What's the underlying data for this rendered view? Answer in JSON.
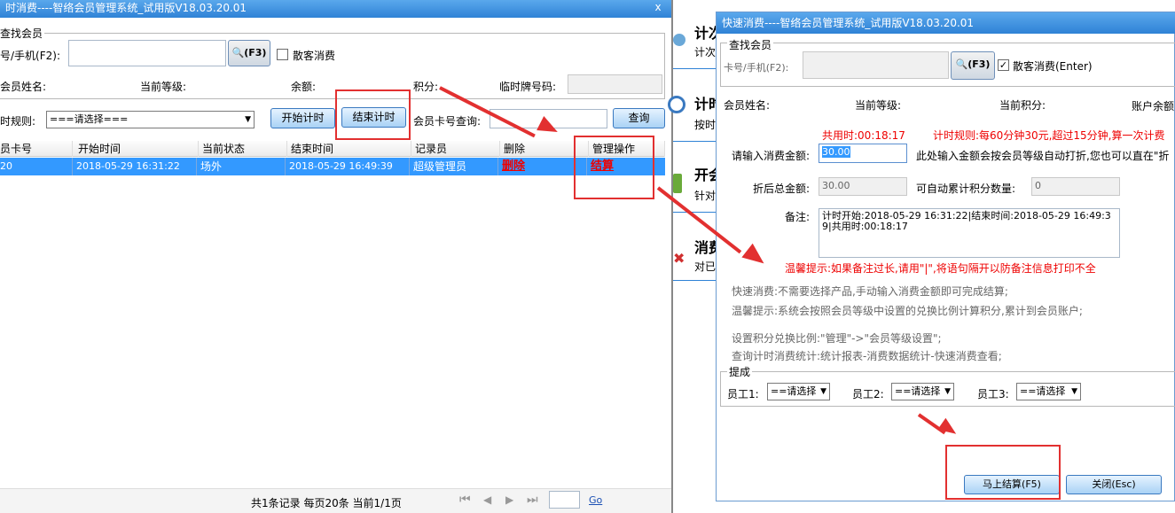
{
  "left_window": {
    "title": "时消费----智络会员管理系统_试用版V18.03.20.01",
    "close_glyph": "x",
    "find_member_group": "查找会员",
    "card_phone_label": "号/手机(F2):",
    "card_phone_value": "",
    "search_button": "(F3)",
    "walkin_label": "散客消费",
    "walkin_checked": false,
    "member_name_label": "会员姓名:",
    "current_level_label": "当前等级:",
    "balance_label": "余额:",
    "points_label": "积分:",
    "temp_card_label": "临时牌号码:",
    "temp_card_value": "",
    "rule_label": "时规则:",
    "rule_select": "===请选择===",
    "start_button": "开始计时",
    "end_button": "结束计时",
    "card_query_label": "会员卡号查询:",
    "card_query_value": "",
    "query_button": "查询",
    "table": {
      "headers": [
        "员卡号",
        "开始时间",
        "当前状态",
        "结束时间",
        "记录员",
        "删除",
        "管理操作"
      ],
      "rows": [
        [
          "20",
          "2018-05-29 16:31:22",
          "场外",
          "2018-05-29 16:49:39",
          "超级管理员",
          "删除",
          "结算"
        ]
      ]
    },
    "pagination": {
      "summary": "共1条记录  每页20条  当前1/1页",
      "first": "⏮",
      "prev": "◀",
      "next": "▶",
      "last": "⏭",
      "page_input": "",
      "go": "Go"
    }
  },
  "middle_panel": {
    "items": [
      {
        "title": "计次",
        "sub": "计次"
      },
      {
        "title": "计时",
        "sub": "按时"
      },
      {
        "title": "开会",
        "sub": "针对"
      },
      {
        "title": "消费",
        "sub": "对已"
      }
    ]
  },
  "right_window": {
    "title": "快速消费----智络会员管理系统_试用版V18.03.20.01",
    "find_member_group": "查找会员",
    "card_phone_label": "卡号/手机(F2):",
    "card_phone_value": "",
    "search_button": "(F3)",
    "walkin_label": "散客消费(Enter)",
    "walkin_checked": true,
    "member_name_label": "会员姓名:",
    "current_level_label": "当前等级:",
    "current_points_label": "当前积分:",
    "account_balance_label": "账户余额",
    "total_time": "共用时:00:18:17",
    "timing_rule": "计时规则:每60分钟30元,超过15分钟,算一次计费",
    "amount_label": "请输入消费金额:",
    "amount_value": "30.00",
    "amount_hint": "此处输入金额会按会员等级自动打折,您也可以直在\"折",
    "discount_total_label": "折后总金额:",
    "discount_total_value": "30.00",
    "points_accum_label": "可自动累计积分数量:",
    "points_accum_value": "0",
    "remark_label": "备注:",
    "remark_value": "计时开始:2018-05-29 16:31:22|结束时间:2018-05-29 16:49:39|共用时:00:18:17",
    "warm_tip": "温馨提示:如果备注过长,请用\"|\",将语句隔开以防备注信息打印不全",
    "info_lines": [
      "快速消费:不需要选择产品,手动输入消费金额即可完成结算;",
      "温馨提示:系统会按照会员等级中设置的兑换比例计算积分,累计到会员账户;",
      "",
      "设置积分兑换比例:\"管理\"->\"会员等级设置\";",
      "查询计时消费统计:统计报表-消费数据统计-快速消费查看;"
    ],
    "commission_group": "提成",
    "staff": [
      {
        "label": "员工1:",
        "value": "==请选择"
      },
      {
        "label": "员工2:",
        "value": "==请选择"
      },
      {
        "label": "员工3:",
        "value": "==请选择"
      }
    ],
    "settle_button": "马上结算(F5)",
    "close_button": "关闭(Esc)"
  },
  "colors": {
    "title_bar": "#2f82d6",
    "selection": "#3399ff",
    "highlight": "#e23030"
  }
}
